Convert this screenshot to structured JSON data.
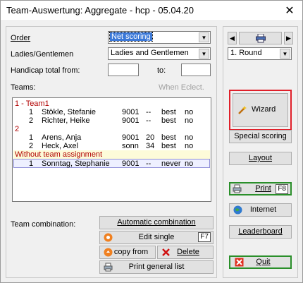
{
  "window": {
    "title": "Team-Auswertung: Aggregate - hcp - 05.04.20",
    "close_glyph": "✕"
  },
  "form": {
    "order_label": "Order",
    "order_value": "Net scoring",
    "ladies_label": "Ladies/Gentlemen",
    "ladies_value": "Ladies and Gentlemen",
    "handicap_label": "Handicap total from:",
    "to_label": "to:",
    "teams_label": "Teams:",
    "when_eclect_label": "When Eclect."
  },
  "teams_list": [
    {
      "kind": "team",
      "text": "1 - Team1"
    },
    {
      "kind": "player",
      "pos": "1",
      "name": "Stökle, Stefanie",
      "club": "9001",
      "hcp": "--",
      "score": "best",
      "flag": "no"
    },
    {
      "kind": "player",
      "pos": "2",
      "name": "Richter, Heike",
      "club": "9001",
      "hcp": "--",
      "score": "best",
      "flag": "no"
    },
    {
      "kind": "team",
      "text": "2"
    },
    {
      "kind": "player",
      "pos": "1",
      "name": "Arens, Anja",
      "club": "9001",
      "hcp": "20",
      "score": "best",
      "flag": "no"
    },
    {
      "kind": "player",
      "pos": "2",
      "name": "Heck, Axel",
      "club": "sonn",
      "hcp": "34",
      "score": "best",
      "flag": "no"
    },
    {
      "kind": "noteam",
      "text": "Without team assignment"
    },
    {
      "kind": "selected",
      "pos": "1",
      "name": "Sonntag, Stephanie",
      "club": "9001",
      "hcp": "--",
      "score": "never",
      "flag": "no"
    }
  ],
  "team_combination": {
    "label": "Team combination:",
    "automatic": "Automatic combination",
    "edit_single": "Edit single",
    "edit_key": "F7",
    "copy_from": "copy from",
    "delete": "Delete",
    "print_general": "Print general list"
  },
  "right_panel": {
    "prev_glyph": "◀",
    "next_glyph": "▶",
    "round_value": "1. Round",
    "wizard": "Wizard",
    "special_scoring": "Special scoring",
    "layout": "Layout",
    "print": "Print",
    "print_key": "F8",
    "internet": "Internet",
    "leaderboard": "Leaderboard",
    "quit": "Quit"
  },
  "colors": {
    "team_red": "#b00000",
    "highlight_border": "#e0202a",
    "print_green": "#2a8f2a"
  }
}
